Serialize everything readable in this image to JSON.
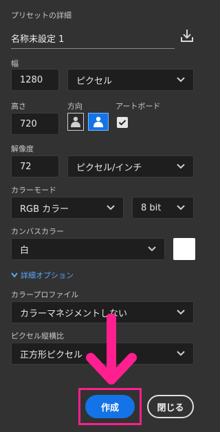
{
  "preset": {
    "title": "プリセットの詳細",
    "name_value": "名称未設定 1"
  },
  "width": {
    "label": "幅",
    "value": "1280",
    "unit": "ピクセル"
  },
  "height": {
    "label": "高さ",
    "value": "720"
  },
  "orientation": {
    "label": "方向",
    "selected": "landscape"
  },
  "artboard": {
    "label": "アートボード",
    "checked": true
  },
  "resolution": {
    "label": "解像度",
    "value": "72",
    "unit": "ピクセル/インチ"
  },
  "color_mode": {
    "label": "カラーモード",
    "mode": "RGB カラー",
    "depth": "8 bit"
  },
  "canvas_color": {
    "label": "カンバスカラー",
    "value": "白",
    "swatch": "#ffffff"
  },
  "advanced": {
    "label": "詳細オプション"
  },
  "color_profile": {
    "label": "カラープロファイル",
    "value": "カラーマネジメントしない"
  },
  "pixel_aspect": {
    "label": "ピクセル縦横比",
    "value": "正方形ピクセル"
  },
  "buttons": {
    "create": "作成",
    "close": "閉じる"
  },
  "colors": {
    "accent": "#1473e6",
    "highlight": "#ff1f8e",
    "background": "#323232"
  }
}
